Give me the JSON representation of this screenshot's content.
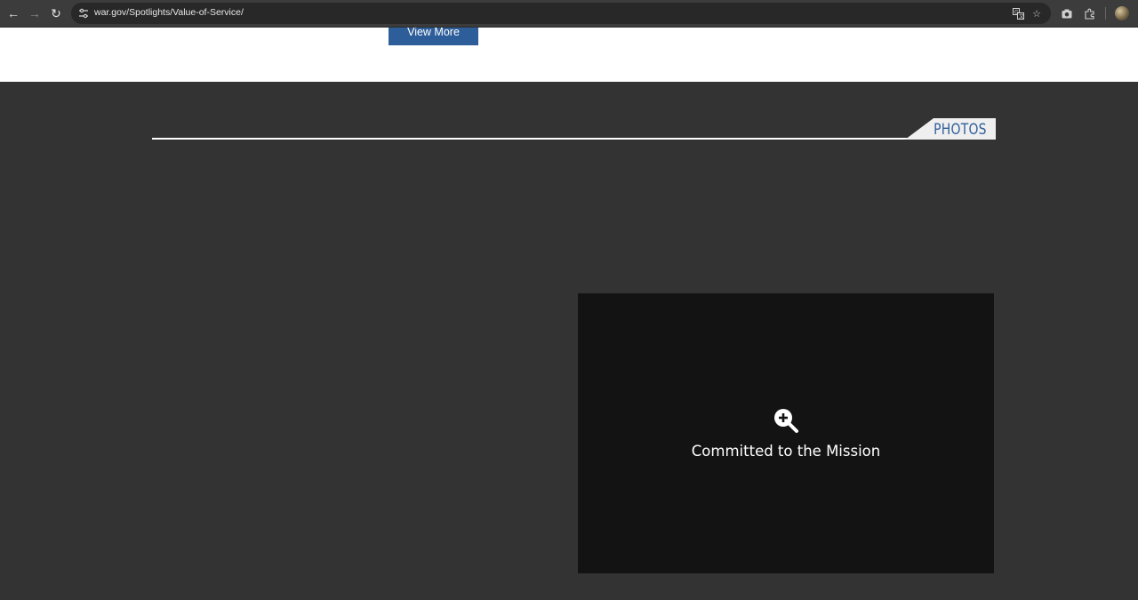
{
  "browser": {
    "url": "war.gov/Spotlights/Value-of-Service/",
    "icons": {
      "back": "back-arrow-icon",
      "forward": "forward-arrow-icon",
      "reload": "reload-icon",
      "site_info": "tune-icon",
      "translate": "translate-icon",
      "bookmark": "star-icon",
      "screenshot": "camera-icon",
      "extensions": "puzzle-icon",
      "profile": "avatar"
    }
  },
  "page": {
    "view_more_label": "View More",
    "section": {
      "tab_label": "PHOTOS"
    },
    "photo_card": {
      "caption": "Committed to the Mission",
      "icon": "zoom-in-icon"
    }
  },
  "colors": {
    "accent_blue": "#2e5e9a",
    "dark_background": "#333333",
    "card_background": "#131313"
  }
}
